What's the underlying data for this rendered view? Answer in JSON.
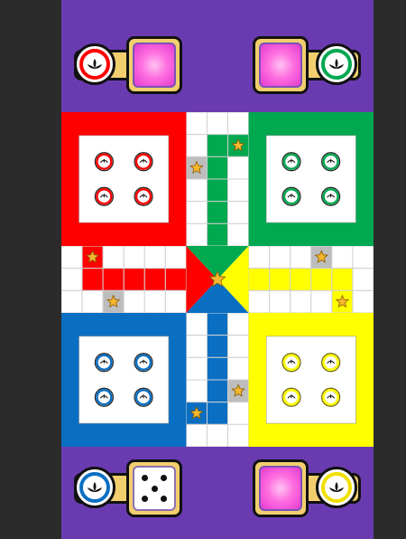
{
  "players": {
    "red": {
      "color": "#ff0000",
      "dark": "#b80000",
      "position": "top-left",
      "dice": "pink-blank"
    },
    "green": {
      "color": "#00a84f",
      "dark": "#006b32",
      "position": "top-right",
      "dice": "pink-blank"
    },
    "blue": {
      "color": "#0a6fc2",
      "dark": "#064a85",
      "position": "bottom-left",
      "dice": "white-5"
    },
    "yellow": {
      "color": "#ffff00",
      "dark": "#b8a800",
      "position": "bottom-right",
      "dice": "pink-blank"
    }
  },
  "colors": {
    "background": "#2b2b2b",
    "board_surround": "#6a3bb0",
    "panel_bar": "#f2cf6e",
    "safe_cell": "#bdbdbd",
    "star": "#f5b82e"
  },
  "icons": {
    "token": "lotus-icon",
    "safe_spot": "star-icon",
    "home": "star-icon"
  },
  "dice": {
    "active_player": "blue",
    "value": 5
  }
}
